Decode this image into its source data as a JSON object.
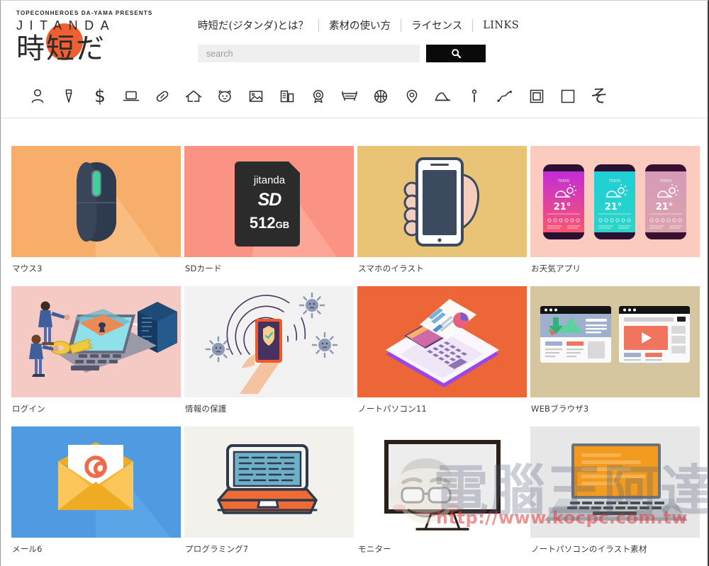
{
  "site": {
    "logo_presents": "TOPECONHEROES DA-YAMA PRESENTS",
    "logo_latin": "JITANDA",
    "logo_japanese": "時短だ",
    "accent_color": "#ef5f32"
  },
  "nav": {
    "items": [
      {
        "label": "時短だ(ジタンダ)とは？"
      },
      {
        "label": "素材の使い方"
      },
      {
        "label": "ライセンス"
      },
      {
        "label": "LINKS"
      }
    ]
  },
  "search": {
    "placeholder": "search",
    "value": "",
    "button_icon": "search-icon"
  },
  "category_icons": [
    {
      "name": "person-icon"
    },
    {
      "name": "necktie-icon"
    },
    {
      "name": "dollar-icon"
    },
    {
      "name": "laptop-icon"
    },
    {
      "name": "capsule-pill-icon"
    },
    {
      "name": "house-icon"
    },
    {
      "name": "cat-face-icon"
    },
    {
      "name": "picture-icon"
    },
    {
      "name": "buildings-icon"
    },
    {
      "name": "award-medal-icon"
    },
    {
      "name": "bench-icon"
    },
    {
      "name": "basketball-icon"
    },
    {
      "name": "map-pin-icon"
    },
    {
      "name": "mountain-icon"
    },
    {
      "name": "exclamation-icon"
    },
    {
      "name": "line-chart-icon"
    },
    {
      "name": "frame-double-icon"
    },
    {
      "name": "frame-single-icon"
    },
    {
      "name": "sono-ta-icon",
      "glyph": "そ"
    }
  ],
  "gallery": {
    "items": [
      {
        "title": "マウス3",
        "bg": "#f7ae6a",
        "kind": "mouse"
      },
      {
        "title": "SDカード",
        "bg": "#fb9384",
        "kind": "sdcard",
        "card_brand": "jitanda",
        "card_type": "SD",
        "card_size": "512",
        "card_unit": "GB"
      },
      {
        "title": "スマホのイラスト",
        "bg": "#e9c476",
        "kind": "smartphone-hand"
      },
      {
        "title": "お天気アプリ",
        "bg": "#fbcbc0",
        "kind": "weather-app",
        "screens": [
          {
            "city": "TOKYO",
            "temp": "21°",
            "tint": "magenta"
          },
          {
            "city": "TOKYO",
            "temp": "21°",
            "tint": "cyan"
          },
          {
            "city": "TOKYO",
            "temp": "21°",
            "tint": "pink"
          }
        ]
      },
      {
        "title": "ログイン",
        "bg": "#f6cac4",
        "kind": "login"
      },
      {
        "title": "情報の保護",
        "bg": "#f2f2f2",
        "kind": "security"
      },
      {
        "title": "ノートパソコン11",
        "bg": "#ec6638",
        "kind": "laptop-iso"
      },
      {
        "title": "WEBブラウザ3",
        "bg": "#d6c6a0",
        "kind": "browsers"
      },
      {
        "title": "メール6",
        "bg": "#4f9ae0",
        "kind": "mail"
      },
      {
        "title": "プログラミング7",
        "bg": "#f2f1ec",
        "kind": "programming"
      },
      {
        "title": "モニター",
        "bg": "#ffffff",
        "kind": "monitor"
      },
      {
        "title": "ノートパソコンのイラスト素材",
        "bg": "#e7e7e7",
        "kind": "laptop-orange"
      }
    ]
  },
  "watermark": {
    "text": "電腦王阿達",
    "url": "http://www.kocpc.com.tw"
  }
}
